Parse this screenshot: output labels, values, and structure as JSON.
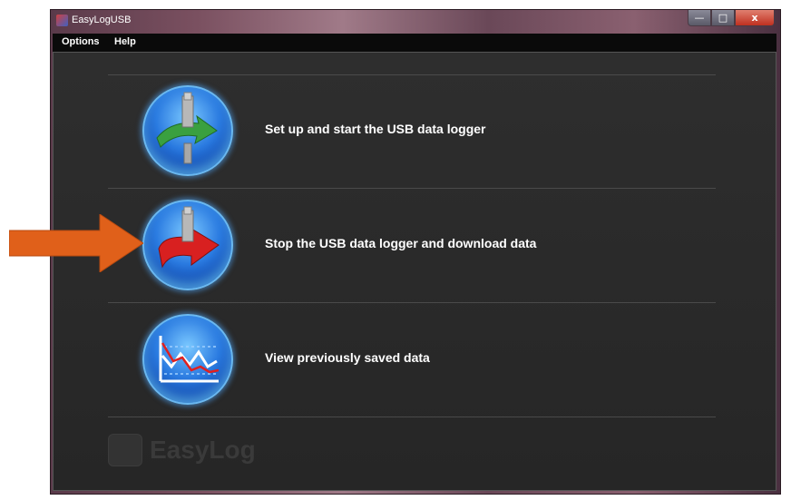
{
  "window": {
    "title": "EasyLogUSB",
    "minimize_glyph": "—",
    "maximize_glyph": "□",
    "close_glyph": "x"
  },
  "menu": {
    "options": "Options",
    "help": "Help"
  },
  "actions": [
    {
      "label": "Set up and start the USB data logger",
      "icon": "usb-setup-icon",
      "arrow_color": "#3aa040"
    },
    {
      "label": "Stop the USB data logger and download data",
      "icon": "usb-download-icon",
      "arrow_color": "#d02020"
    },
    {
      "label": "View previously saved data",
      "icon": "chart-view-icon"
    }
  ],
  "logo": {
    "text": "EasyLog"
  },
  "annotation": {
    "arrow_color": "#e0601a"
  }
}
